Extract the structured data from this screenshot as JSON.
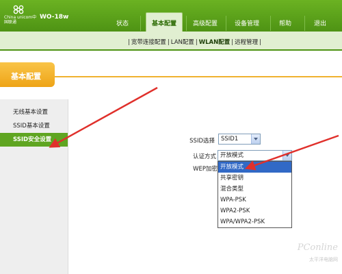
{
  "header": {
    "logo_text": "China unicom中国联通",
    "model": "WO-18w",
    "nav": [
      {
        "label": "状态"
      },
      {
        "label": "基本配置"
      },
      {
        "label": "高级配置"
      },
      {
        "label": "设备管理"
      },
      {
        "label": "帮助"
      },
      {
        "label": "退出"
      }
    ],
    "active_index": 1
  },
  "subnav": {
    "items": [
      "宽带连接配置",
      "LAN配置",
      "WLAN配置",
      "远程管理"
    ],
    "active": "WLAN配置",
    "separator": "|"
  },
  "banner": {
    "title": "基本配置"
  },
  "sidebar": {
    "items": [
      {
        "label": "无线基本设置"
      },
      {
        "label": "SSID基本设置"
      },
      {
        "label": "SSID安全设置"
      }
    ],
    "active": "SSID安全设置"
  },
  "form": {
    "ssid_label": "SSID选择",
    "ssid_value": "SSID1",
    "auth_label": "认证方式",
    "auth_value": "开放模式",
    "wep_label": "WEP加密",
    "auth_options": [
      {
        "label": "开放模式"
      },
      {
        "label": "共享密钥"
      },
      {
        "label": "混合类型"
      },
      {
        "label": "WPA-PSK"
      },
      {
        "label": "WPA2-PSK"
      },
      {
        "label": "WPA/WPA2-PSK"
      }
    ],
    "selected_option_index": 0
  },
  "watermark": {
    "text": "PConline",
    "sub": "太平洋电脑网"
  },
  "colors": {
    "header_green": "#4e9314",
    "banner_orange": "#eea417",
    "selected_blue": "#3169c6",
    "arrow_red": "#e0302b"
  },
  "icons": [
    "unicom-logo-icon",
    "select-arrow-icon",
    "annotation-arrow-icon"
  ]
}
